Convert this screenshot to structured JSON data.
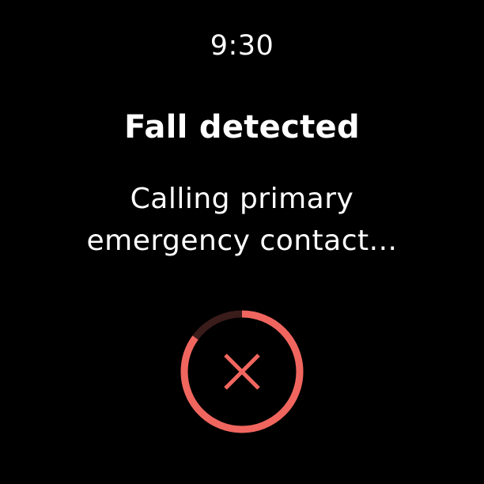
{
  "status_bar": {
    "time": "9:30"
  },
  "alert": {
    "title": "Fall detected",
    "message": "Calling primary emergency contact..."
  },
  "cancel_button": {
    "icon": "close-icon",
    "countdown_progress": 0.85
  },
  "colors": {
    "background": "#000000",
    "text": "#ffffff",
    "accent": "#f0665f",
    "track": "#3a1c1b"
  }
}
